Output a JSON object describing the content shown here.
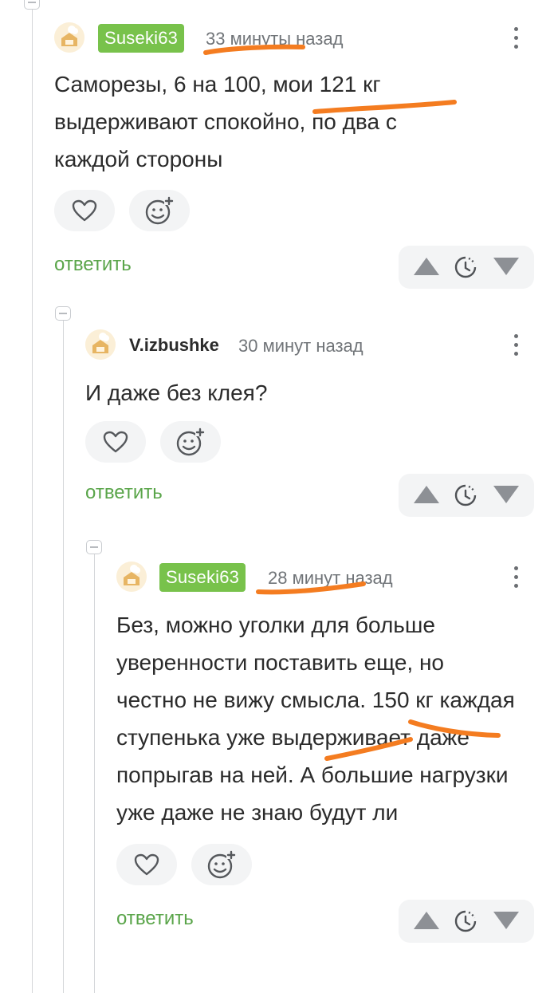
{
  "comments": [
    {
      "author": "Suseki63",
      "time": "33 минуты назад",
      "text": "Саморезы, 6 на 100, мои 121 кг выдерживают спокойно, по два с каждой стороны",
      "reply_label": "ответить"
    },
    {
      "author": "V.izbushke",
      "time": "30 минут назад",
      "text": "И даже без клея?",
      "reply_label": "ответить"
    },
    {
      "author": "Suseki63",
      "time": "28 минут назад",
      "text": "Без, можно уголки для больше уверенности поставить еще, но честно не вижу смысла. 150 кг каждая ступенька уже выдерживает даже попрыгав на ней. А большие нагрузки уже даже не знаю будут ли",
      "reply_label": "ответить"
    }
  ],
  "icons": {
    "like": "heart-icon",
    "reaction": "smile-plus-icon",
    "upvote": "arrow-up-icon",
    "rating": "clock-icon",
    "downvote": "arrow-down-icon",
    "menu": "more-vertical-icon",
    "collapse": "collapse-icon"
  },
  "colors": {
    "badge": "#78c24b",
    "reply": "#5aa54a",
    "highlight": "#f47c20"
  }
}
